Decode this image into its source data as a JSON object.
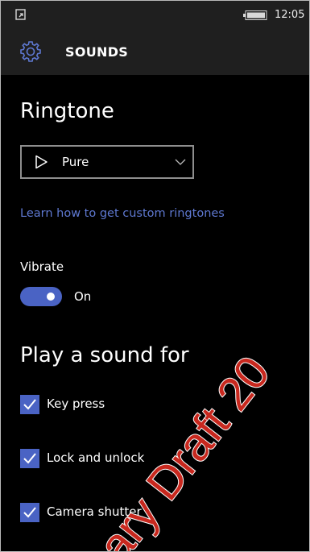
{
  "status_bar": {
    "time": "12:05",
    "left_icon": "notification-icon",
    "battery_icon": "battery-icon"
  },
  "header": {
    "title": "SOUNDS",
    "icon": "gear-icon"
  },
  "ringtone": {
    "heading": "Ringtone",
    "selected": "Pure",
    "link": "Learn how to get custom ringtones"
  },
  "vibrate": {
    "label": "Vibrate",
    "state": "On",
    "enabled": true
  },
  "play_sound": {
    "heading": "Play a sound for",
    "items": [
      {
        "label": "Key press",
        "checked": true
      },
      {
        "label": "Lock and unlock",
        "checked": true
      },
      {
        "label": "Camera shutter",
        "checked": true
      }
    ]
  },
  "watermark": {
    "text": "ary Draft 20"
  },
  "colors": {
    "accent": "#4a63c4",
    "link": "#5e78d0",
    "header_bg": "#1f1f1f",
    "background": "#000000",
    "watermark": "#c8281e"
  }
}
